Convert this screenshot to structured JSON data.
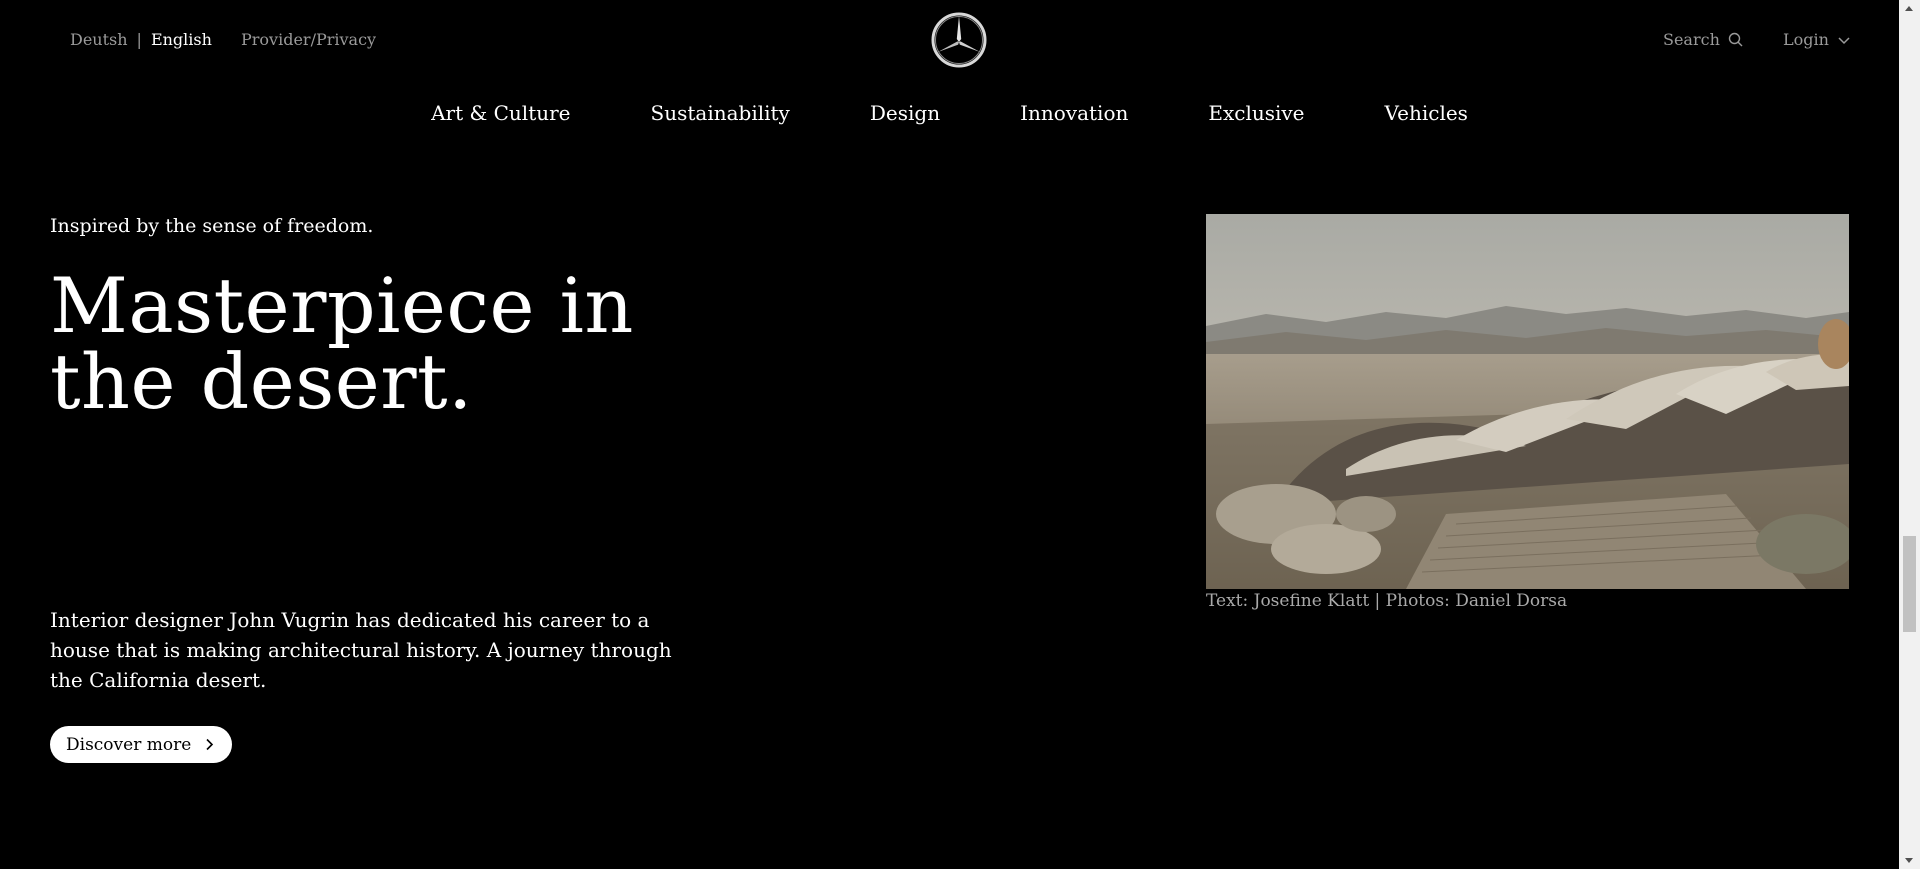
{
  "header": {
    "lang_de": "Deutsh",
    "lang_sep": "|",
    "lang_en": "English",
    "provider": "Provider/Privacy",
    "logo_icon": "mercedes-star-icon",
    "search_label": "Search",
    "search_icon": "search-icon",
    "login_label": "Login",
    "login_icon": "chevron-down-icon"
  },
  "nav": {
    "items": [
      "Art & Culture",
      "Sustainability",
      "Design",
      "Innovation",
      "Exclusive",
      "Vehicles"
    ]
  },
  "hero": {
    "eyebrow": "Inspired by the sense of freedom.",
    "title_line1": "Masterpiece in",
    "title_line2": "the desert.",
    "description": "Interior designer John Vugrin has dedicated his career to a house that is making architectural history. A journey through the California desert.",
    "cta_label": "Discover more",
    "cta_icon": "chevron-right-icon",
    "caption": "Text: Josefine Klatt | Photos: Daniel Dorsa"
  },
  "colors": {
    "background": "#000000",
    "text": "#ffffff",
    "muted": "#9a9a9a"
  }
}
